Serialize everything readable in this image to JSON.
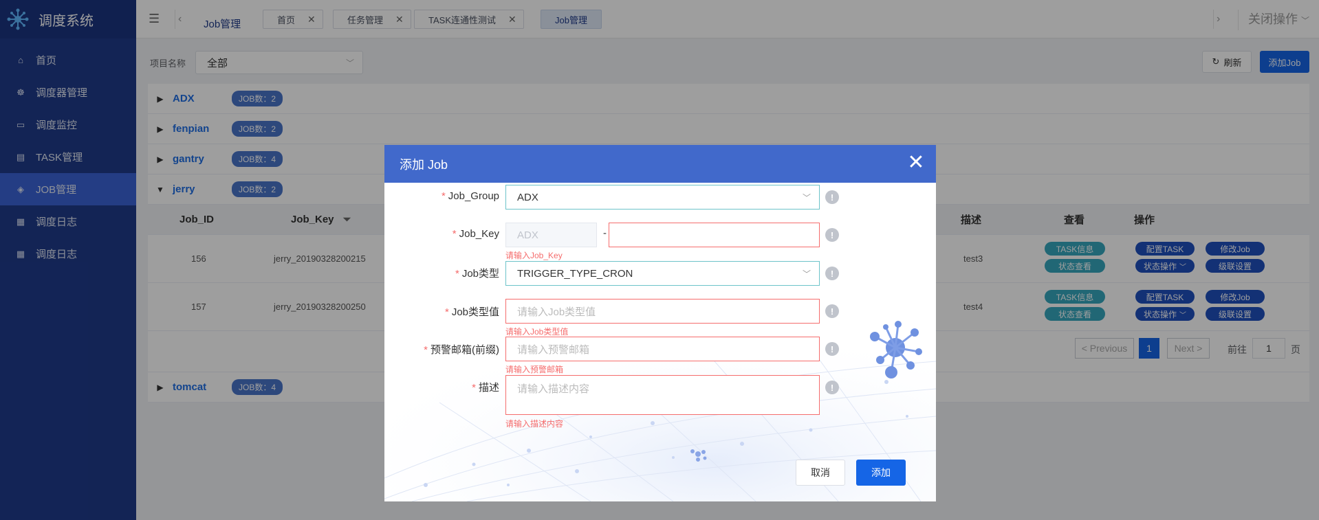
{
  "app": {
    "title": "调度系统"
  },
  "sidebar": {
    "items": [
      {
        "label": "首页",
        "icon": "home-icon",
        "active": false
      },
      {
        "label": "调度器管理",
        "icon": "scheduler-icon",
        "active": false
      },
      {
        "label": "调度监控",
        "icon": "monitor-icon",
        "active": false
      },
      {
        "label": "TASK管理",
        "icon": "task-icon",
        "active": false
      },
      {
        "label": "JOB管理",
        "icon": "job-icon",
        "active": true
      },
      {
        "label": "调度日志",
        "icon": "log-icon",
        "active": false
      },
      {
        "label": "调度日志",
        "icon": "log-icon",
        "active": false
      }
    ]
  },
  "header": {
    "breadcrumb": "Job管理",
    "tabs": [
      {
        "label": "首页",
        "active": false
      },
      {
        "label": "任务管理",
        "active": false
      },
      {
        "label": "TASK连通性测试",
        "active": false
      },
      {
        "label": "Job管理",
        "active": true
      }
    ],
    "close_ops": "关闭操作"
  },
  "filter": {
    "label": "项目名称",
    "value": "全部",
    "refresh": "刷新",
    "add_job": "添加Job"
  },
  "groups": [
    {
      "name": "ADX",
      "badge": "JOB数：2",
      "expanded": false
    },
    {
      "name": "fenpian",
      "badge": "JOB数：2",
      "expanded": false
    },
    {
      "name": "gantry",
      "badge": "JOB数：4",
      "expanded": false
    },
    {
      "name": "jerry",
      "badge": "JOB数：2",
      "expanded": true
    },
    {
      "name": "tomcat",
      "badge": "JOB数：4",
      "expanded": false
    }
  ],
  "table": {
    "columns": {
      "job_id": "Job_ID",
      "job_key": "Job_Key",
      "desc": "描述",
      "view": "查看",
      "ops": "操作"
    },
    "rows": [
      {
        "job_id": "156",
        "job_key": "jerry_20190328200215",
        "desc": "test3"
      },
      {
        "job_id": "157",
        "job_key": "jerry_20190328200250",
        "desc": "test4"
      }
    ],
    "actions": {
      "task_info": "TASK信息",
      "status_view": "状态查看",
      "config_task": "配置TASK",
      "status_ops": "状态操作",
      "edit_job": "修改Job",
      "cascade": "级联设置"
    },
    "pagination": {
      "prev": "< Previous",
      "current": "1",
      "next": "Next >",
      "goto": "前往",
      "page_input": "1",
      "page_unit": "页"
    }
  },
  "dialog": {
    "title": "添加 Job",
    "fields": {
      "job_group": {
        "label": "Job_Group",
        "value": "ADX"
      },
      "job_key": {
        "label": "Job_Key",
        "prefix": "ADX",
        "separator": "-",
        "error": "请输入Job_Key"
      },
      "job_type": {
        "label": "Job类型",
        "value": "TRIGGER_TYPE_CRON"
      },
      "job_type_value": {
        "label": "Job类型值",
        "placeholder": "请输入Job类型值",
        "error": "请输入Job类型值"
      },
      "alert_email": {
        "label": "预警邮箱(前缀)",
        "placeholder": "请输入预警邮箱",
        "error": "请输入预警邮箱"
      },
      "description": {
        "label": "描述",
        "placeholder": "请输入描述内容",
        "error": "请输入描述内容"
      }
    },
    "required_mark": "*",
    "info_mark": "!",
    "cancel": "取消",
    "submit": "添加"
  }
}
